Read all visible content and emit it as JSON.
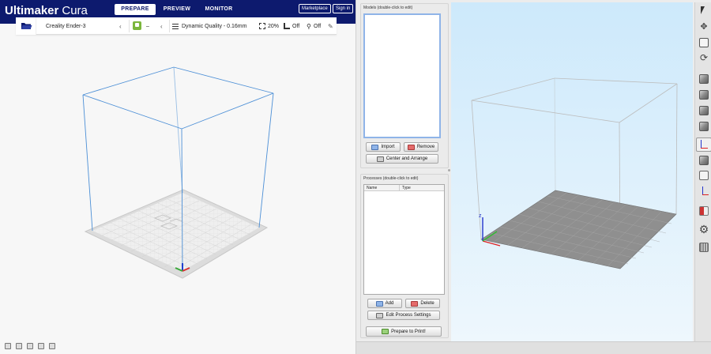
{
  "cura": {
    "brand": "Ultimaker",
    "brand_suffix": "Cura",
    "tabs": [
      {
        "label": "PREPARE",
        "active": true
      },
      {
        "label": "PREVIEW",
        "active": false
      },
      {
        "label": "MONITOR",
        "active": false
      }
    ],
    "marketplace_label": "Marketplace",
    "signin_label": "Sign in",
    "printer_name": "Creality Ender-3",
    "extruder_dash": "–",
    "profile_name": "Dynamic Quality - 0.16mm",
    "infill": "20%",
    "support": "Off",
    "adhesion": "Off",
    "colors": {
      "header": "#0d1a6e",
      "volume_edge": "#4c8fd6"
    }
  },
  "slicer": {
    "models_title": "Models (double-click to edit)",
    "import_label": "Import",
    "remove_label": "Remove",
    "center_label": "Center and Arrange",
    "processes_title": "Processes (double-click to edit)",
    "col_name": "Name",
    "col_type": "Type",
    "add_label": "Add",
    "delete_label": "Delete",
    "edit_process_label": "Edit Process Settings",
    "prepare_label": "Prepare to Print!",
    "colors": {
      "bed": "#8f8f8f",
      "sky_top": "#cde9fb"
    }
  }
}
